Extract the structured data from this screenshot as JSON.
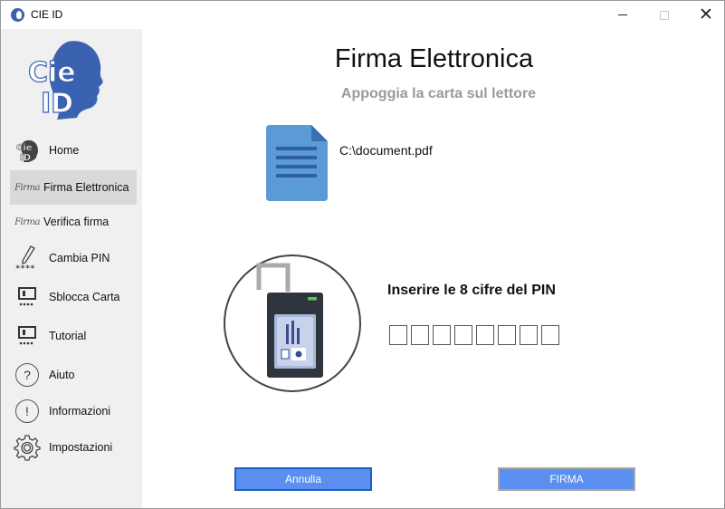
{
  "window": {
    "title": "CIE ID"
  },
  "sidebar": {
    "items": [
      {
        "label": "Home",
        "icon": "cie-id-icon",
        "active": false
      },
      {
        "label": "Firma Elettronica",
        "icon": "signature-icon",
        "active": true
      },
      {
        "label": "Verifica firma",
        "icon": "signature-icon",
        "active": false
      },
      {
        "label": "Cambia PIN",
        "icon": "pen-pin-icon",
        "active": false
      },
      {
        "label": "Sblocca Carta",
        "icon": "card-reader-icon",
        "active": false
      },
      {
        "label": "Tutorial",
        "icon": "card-reader-icon",
        "active": false
      },
      {
        "label": "Aiuto",
        "icon": "question-icon",
        "active": false
      },
      {
        "label": "Informazioni",
        "icon": "info-icon",
        "active": false
      },
      {
        "label": "Impostazioni",
        "icon": "gear-icon",
        "active": false
      }
    ]
  },
  "main": {
    "title": "Firma Elettronica",
    "subtitle": "Appoggia la carta sul lettore",
    "document_path": "C:\\document.pdf",
    "pin_prompt": "Inserire le 8 cifre del PIN",
    "cancel_label": "Annulla",
    "sign_label": "FIRMA"
  },
  "colors": {
    "accent": "#5b8fef",
    "logo_blue": "#3a62b0",
    "document_blue": "#5b9bd5"
  }
}
